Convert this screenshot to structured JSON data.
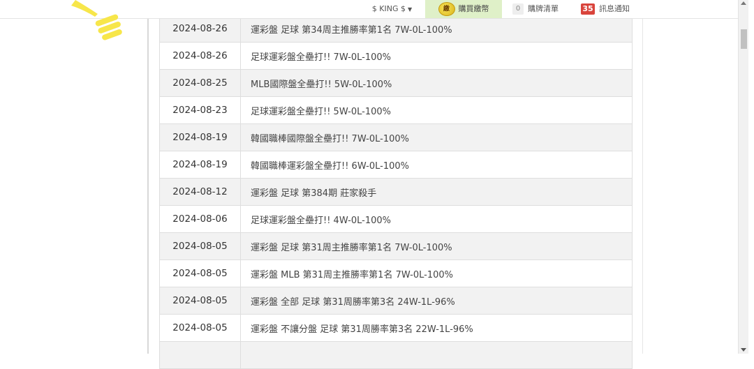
{
  "nav": {
    "user_label": "$ KING $",
    "buy_label": "購買繳幣",
    "coin_glyph": "繳",
    "cart_count": "0",
    "cart_label": "購牌清單",
    "msg_count": "35",
    "msg_label": "訊息通知"
  },
  "colors": {
    "buy_bg": "#dff0c8",
    "badge_red": "#d9443c",
    "deco_yellow": "#f7e64a"
  },
  "rows": [
    {
      "date": "2024-08-26",
      "title": "運彩盤 足球 第34周主推勝率第1名 7W-0L-100%"
    },
    {
      "date": "2024-08-26",
      "title": "足球運彩盤全壘打!! 7W-0L-100%"
    },
    {
      "date": "2024-08-25",
      "title": "MLB國際盤全壘打!! 5W-0L-100%"
    },
    {
      "date": "2024-08-23",
      "title": "足球運彩盤全壘打!! 5W-0L-100%"
    },
    {
      "date": "2024-08-19",
      "title": "韓國職棒國際盤全壘打!! 7W-0L-100%"
    },
    {
      "date": "2024-08-19",
      "title": "韓國職棒運彩盤全壘打!! 6W-0L-100%"
    },
    {
      "date": "2024-08-12",
      "title": "運彩盤 足球 第384期 莊家殺手"
    },
    {
      "date": "2024-08-06",
      "title": "足球運彩盤全壘打!! 4W-0L-100%"
    },
    {
      "date": "2024-08-05",
      "title": "運彩盤 足球 第31周主推勝率第1名 7W-0L-100%"
    },
    {
      "date": "2024-08-05",
      "title": "運彩盤 MLB 第31周主推勝率第1名 7W-0L-100%"
    },
    {
      "date": "2024-08-05",
      "title": "運彩盤 全部 足球 第31周勝率第3名 24W-1L-96%"
    },
    {
      "date": "2024-08-05",
      "title": "運彩盤 不讓分盤 足球 第31周勝率第3名 22W-1L-96%"
    },
    {
      "date": "",
      "title": ""
    }
  ]
}
